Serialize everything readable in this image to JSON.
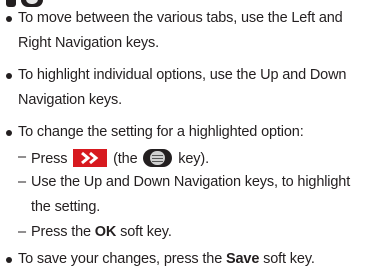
{
  "instructions": {
    "item1_line1": "To move between the various tabs, use the Left and",
    "item1_line2": "Right Navigation keys.",
    "item2_line1": "To highlight individual options, use the Up and Down",
    "item2_line2": "Navigation keys.",
    "item3_line1": "To change the setting for a highlighted option:",
    "sub1_prefix": "Press",
    "sub1_middle": "(the",
    "sub1_suffix": "key).",
    "sub2_line1": "Use the Up and Down Navigation keys, to highlight",
    "sub2_line2": "the setting.",
    "sub3_prefix": "Press the",
    "sub3_bold": "OK",
    "sub3_suffix": "soft key.",
    "item4_prefix": "To save your changes, press the",
    "item4_bold": "Save",
    "item4_suffix": "soft key."
  },
  "icons": {
    "forward": "double-chevron-right-icon",
    "key": "navigation-center-key-icon"
  },
  "colors": {
    "text": "#231f20",
    "accent": "#d7191f"
  }
}
